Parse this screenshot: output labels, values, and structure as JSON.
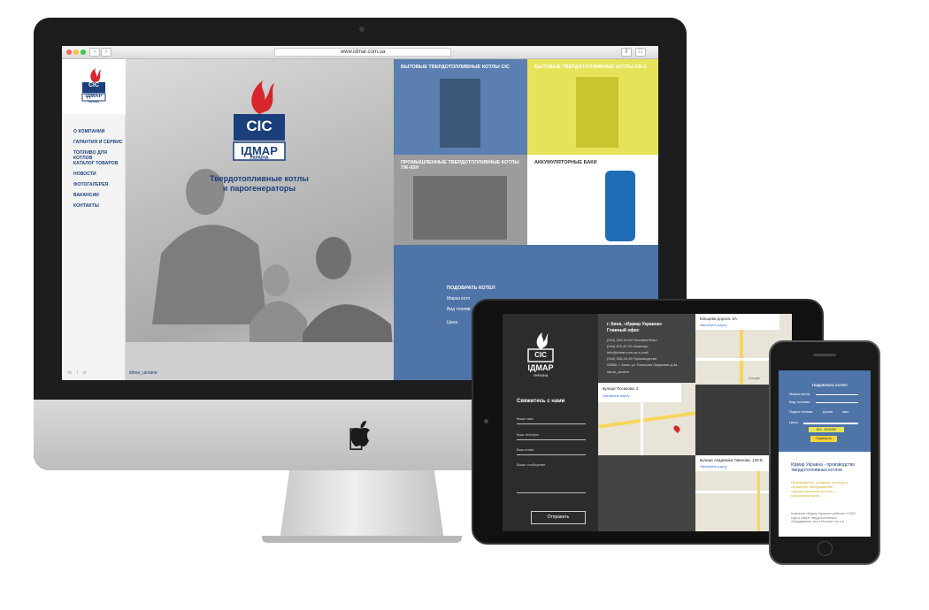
{
  "brand": {
    "logo_top": "CIC",
    "logo_main": "ІДМАР",
    "logo_sub": "УКРАЇНА",
    "tagline_line1": "Твердотопливные котлы",
    "tagline_line2": "и парогенераторы",
    "colors": {
      "navy": "#1b3f7a",
      "red": "#d7262c",
      "slate_blue": "#4f74a8",
      "yellow": "#e6e35a",
      "dark": "#2c2c2c"
    }
  },
  "browser": {
    "url": "www.idmar.com.ua"
  },
  "desktop": {
    "menu": [
      "О КОМПАНИИ",
      "ГАРАНТИЯ И СЕРВИС",
      "ТОПЛИВО ДЛЯ КОТЛОВ",
      "КАТАЛОГ ТОВАРОВ",
      "НОВОСТИ",
      "ФОТОГАЛЕРЕЯ",
      "ВАКАНСИИ",
      "КОНТАКТЫ"
    ],
    "social_handle": "idmar_ukraine",
    "tiles": [
      {
        "title": "БЫТОВЫЕ ТВЕРДОТОПЛИВНЫЕ КОТЛЫ CIC"
      },
      {
        "title": "БЫТОВЫЕ ТВЕРДОТОПЛИВНЫЕ КОТЛЫ GB-3"
      },
      {
        "title": "ПРОМЫШЛЕННЫЕ ТВЕРДОТОПЛИВНЫЕ КОТЛЫ УЖ-65Н"
      },
      {
        "title": "АККУМУЛЯТОРНЫЕ БАКИ"
      }
    ],
    "picker": {
      "title": "ПОДОБРАТЬ КОТЕЛ",
      "row1": "Марка котл",
      "row2": "Вид топлив",
      "row3": "Цена"
    }
  },
  "tablet": {
    "office": {
      "city": "г. Киев, «Идмар Украина»",
      "label": "Главный офис",
      "lines": [
        "(044) 393-34-69 Телефон/Факс",
        "(044) 870-87-94 Инженер",
        "info@idmar.com.ua e-mail",
        "(044) 393-34-39 Производство",
        "03680, г. Киев, ул. Большая Окружная д.4а"
      ],
      "skype": "idmar_ukraine"
    },
    "contact": {
      "heading": "Свяжитесь с нами",
      "fields": [
        "Ваше имя",
        "Ваш телефон",
        "Ваш email",
        "Ваше сообщение"
      ],
      "submit": "Отправить"
    },
    "maps": [
      {
        "address": "Кільцева дорога, 4А",
        "link": "Увеличить карту"
      },
      {
        "address": "вулиця Пєсикова, 2",
        "link": "Увеличить карту"
      },
      {
        "address": "вулиця Академіка Павлова, 120-Б",
        "link": "Увеличить карту"
      }
    ],
    "footnote": "Google"
  },
  "phone": {
    "picker": {
      "title": "ПОДОБРАТЬ КОТЕЛ",
      "row1": "Марка котла",
      "row2": "Вид топлива",
      "row3": "Подача топлива:",
      "opt1": "ручная",
      "opt2": "авто",
      "row4": "Цена",
      "price": "$10 - $100000",
      "button": "Подобрать"
    },
    "headline": "Идмар Украина - производство твердотопливных котлов",
    "subhead": "Производство, продажа, монтаж и сервисное обслуживание твердотопливных котлов и парогенераторов",
    "body": "Компания «Идмар Украина» работает с 2002 года в сфере твердотопливного оборудования, как в Бельгии, так и в"
  }
}
